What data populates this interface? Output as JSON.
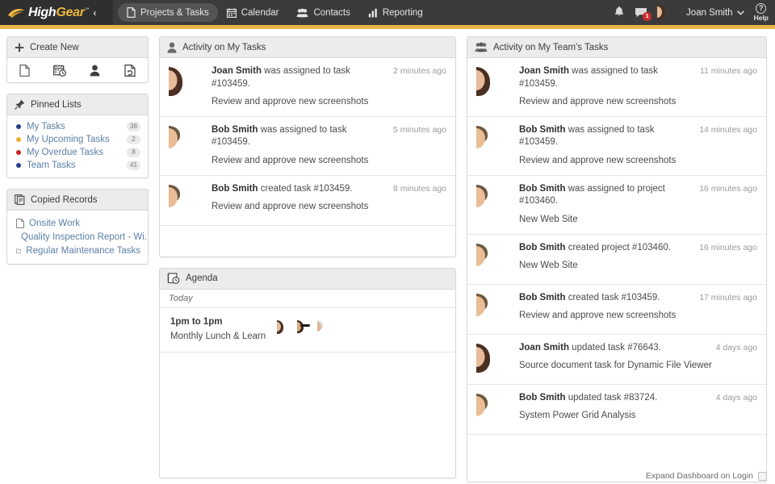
{
  "brand": {
    "name_part1": "High",
    "name_part2": "Gear",
    "trademark": "™",
    "collapse_caret": "‹",
    "logo_gold": "#f0b93f",
    "header_bg": "#3b3b3b",
    "accent_bar": "#eab64a"
  },
  "nav": {
    "tabs": [
      {
        "label": "Projects & Tasks",
        "icon": "document-icon",
        "active": true
      },
      {
        "label": "Calendar",
        "icon": "calendar-icon",
        "active": false
      },
      {
        "label": "Contacts",
        "icon": "contacts-icon",
        "active": false
      },
      {
        "label": "Reporting",
        "icon": "bar-chart-icon",
        "active": false
      }
    ]
  },
  "topbar_right": {
    "notifications_icon": "bell-icon",
    "messages_icon": "chat-bubble-icon",
    "messages_badge": "1",
    "messages_badge_color": "#cf2c2c",
    "avatar": "user-avatar",
    "user_name": "Joan Smith",
    "user_caret": "⌄",
    "help_glyph": "?",
    "help_label": "Help"
  },
  "sidebar": {
    "create_new": {
      "title": "Create New",
      "icon": "plus-icon",
      "actions": [
        {
          "icon": "new-document-icon",
          "name": "create-task"
        },
        {
          "icon": "calendar-clock-icon",
          "name": "create-event"
        },
        {
          "icon": "person-icon",
          "name": "create-contact"
        },
        {
          "icon": "document-refresh-icon",
          "name": "create-recurring"
        }
      ]
    },
    "pinned_lists": {
      "title": "Pinned Lists",
      "icon": "pin-icon",
      "items": [
        {
          "label": "My Tasks",
          "count": "38",
          "color": "#23408e"
        },
        {
          "label": "My Upcoming Tasks",
          "count": "2",
          "color": "#e8b031"
        },
        {
          "label": "My Overdue Tasks",
          "count": "8",
          "color": "#cc2222"
        },
        {
          "label": "Team Tasks",
          "count": "41",
          "color": "#23408e"
        }
      ]
    },
    "copied_records": {
      "title": "Copied Records",
      "icon": "copy-icon",
      "items": [
        {
          "label": "Onsite Work",
          "icon": "document-icon"
        },
        {
          "label": "Quality Inspection Report - Wi...",
          "icon": "document-icon"
        },
        {
          "label": "Regular Maintenance Tasks",
          "icon": "folder-icon"
        }
      ]
    }
  },
  "my_tasks_panel": {
    "title": "Activity on My Tasks",
    "icon": "person-icon",
    "items": [
      {
        "actor": "Joan Smith",
        "action": " was assigned to task #103459.",
        "detail": "Review and approve new screenshots",
        "time": "2 minutes ago",
        "avatar": "joan"
      },
      {
        "actor": "Bob Smith",
        "action": " was assigned to task #103459.",
        "detail": "Review and approve new screenshots",
        "time": "5 minutes ago",
        "avatar": "bob"
      },
      {
        "actor": "Bob Smith",
        "action": " created task #103459.",
        "detail": "Review and approve new screenshots",
        "time": "8 minutes ago",
        "avatar": "bob"
      }
    ]
  },
  "agenda_panel": {
    "title": "Agenda",
    "icon": "agenda-clock-icon",
    "day_label": "Today",
    "event": {
      "time": "1pm to 1pm",
      "title": "Monthly Lunch & Learn",
      "attendees": [
        "joan",
        "woman-sunglasses",
        "older-man"
      ]
    }
  },
  "team_panel": {
    "title": "Activity on My Team's Tasks",
    "icon": "group-icon",
    "items": [
      {
        "actor": "Joan Smith",
        "action": " was assigned to task #103459.",
        "detail": "Review and approve new screenshots",
        "time": "11 minutes ago",
        "avatar": "joan"
      },
      {
        "actor": "Bob Smith",
        "action": " was assigned to task #103459.",
        "detail": "Review and approve new screenshots",
        "time": "14 minutes ago",
        "avatar": "bob"
      },
      {
        "actor": "Bob Smith",
        "action": " was assigned to project #103460.",
        "detail": "New Web Site",
        "time": "16 minutes ago",
        "avatar": "bob"
      },
      {
        "actor": "Bob Smith",
        "action": " created project #103460.",
        "detail": "New Web Site",
        "time": "16 minutes ago",
        "avatar": "bob"
      },
      {
        "actor": "Bob Smith",
        "action": " created task #103459.",
        "detail": "Review and approve new screenshots",
        "time": "17 minutes ago",
        "avatar": "bob"
      },
      {
        "actor": "Joan Smith",
        "action": " updated task #76643.",
        "detail": "Source document task for Dynamic File Viewer",
        "time": "4 days ago",
        "avatar": "joan"
      },
      {
        "actor": "Bob Smith",
        "action": " updated task #83724.",
        "detail": "System Power Grid Analysis",
        "time": "4 days ago",
        "avatar": "bob"
      }
    ]
  },
  "footer": {
    "label": "Expand Dashboard on Login",
    "checked": false
  }
}
